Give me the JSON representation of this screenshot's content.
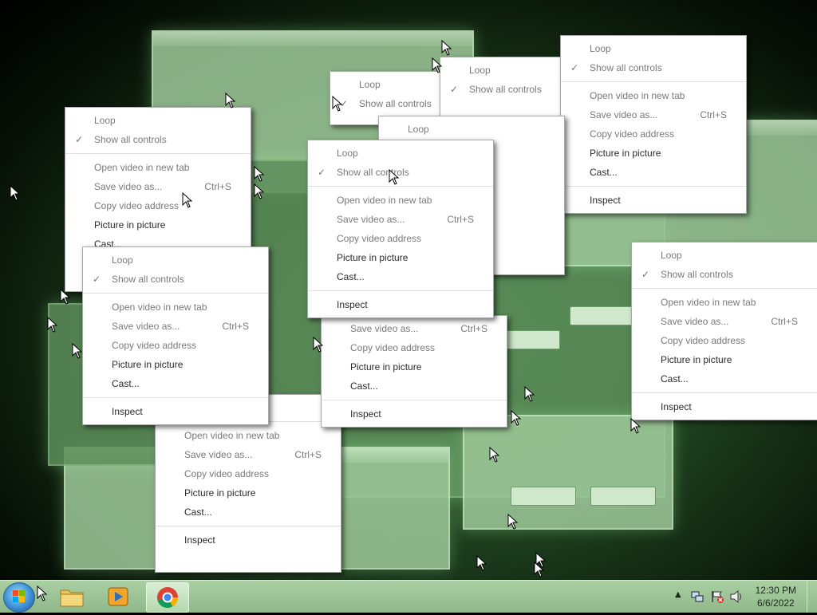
{
  "context_menu": {
    "loop": "Loop",
    "show_all_controls": "Show all controls",
    "open_new_tab": "Open video in new tab",
    "save_video": "Save video as...",
    "save_shortcut": "Ctrl+S",
    "copy_address": "Copy video address",
    "picture_in_picture": "Picture in picture",
    "cast": "Cast...",
    "inspect": "Inspect"
  },
  "taskbar": {
    "apps": [
      "start-button",
      "windows-explorer",
      "media-player",
      "google-chrome"
    ],
    "time": "12:30 PM",
    "date": "6/6/2022"
  },
  "colors": {
    "menu_bg": "#ffffff",
    "tint": "#9ec99a",
    "taskbar": "#9fc799"
  }
}
